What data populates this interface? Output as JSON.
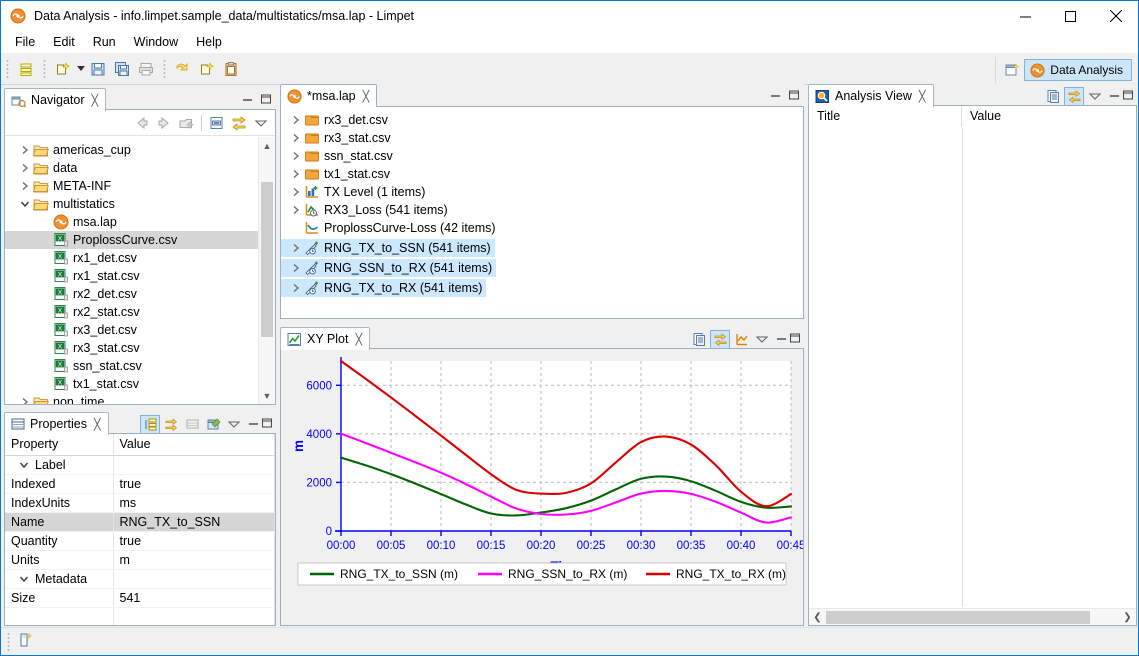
{
  "window": {
    "title": "Data Analysis - info.limpet.sample_data/multistatics/msa.lap - Limpet",
    "app_icon": "limpet-icon",
    "minimize_label": "Minimize",
    "maximize_label": "Maximize",
    "close_label": "Close"
  },
  "menubar": {
    "items": [
      "File",
      "Edit",
      "Run",
      "Window",
      "Help"
    ]
  },
  "toolbar": {
    "buttons": [
      {
        "name": "list-view-icon",
        "title": "Views"
      },
      {
        "name": "new-wizard-icon",
        "title": "New"
      },
      {
        "name": "new-dropdown-arrow",
        "title": "New options"
      },
      {
        "name": "save-icon",
        "title": "Save"
      },
      {
        "name": "save-all-icon",
        "title": "Save All"
      },
      {
        "name": "print-icon",
        "title": "Print"
      },
      {
        "name": "run-icon",
        "title": "Run"
      },
      {
        "name": "new-file-icon",
        "title": "New File"
      },
      {
        "name": "paste-icon",
        "title": "Paste"
      }
    ]
  },
  "perspective": {
    "open_icon": "open-perspective-icon",
    "active": {
      "label": "Data Analysis",
      "icon": "limpet-icon"
    }
  },
  "navigator": {
    "tab": {
      "label": "Navigator",
      "icon": "navigator-icon",
      "close": "╳"
    },
    "tools": [
      {
        "name": "back-icon"
      },
      {
        "name": "forward-icon"
      },
      {
        "name": "up-icon"
      },
      {
        "name": "collapse-all-icon"
      },
      {
        "name": "link-with-editor-icon"
      },
      {
        "name": "view-menu-icon"
      }
    ],
    "view_min": "–",
    "view_max": "❐",
    "items": [
      {
        "label": "americas_cup",
        "icon": "folder-icon",
        "indent": 1,
        "twisty": "collapsed",
        "selected": false
      },
      {
        "label": "data",
        "icon": "folder-icon",
        "indent": 1,
        "twisty": "collapsed",
        "selected": false
      },
      {
        "label": "META-INF",
        "icon": "folder-icon",
        "indent": 1,
        "twisty": "collapsed",
        "selected": false
      },
      {
        "label": "multistatics",
        "icon": "folder-icon",
        "indent": 1,
        "twisty": "expanded",
        "selected": false
      },
      {
        "label": "msa.lap",
        "icon": "limpet-icon",
        "indent": 2,
        "twisty": "none",
        "selected": false
      },
      {
        "label": "ProplossCurve.csv",
        "icon": "csv-icon",
        "indent": 2,
        "twisty": "none",
        "selected": true
      },
      {
        "label": "rx1_det.csv",
        "icon": "csv-icon",
        "indent": 2,
        "twisty": "none",
        "selected": false
      },
      {
        "label": "rx1_stat.csv",
        "icon": "csv-icon",
        "indent": 2,
        "twisty": "none",
        "selected": false
      },
      {
        "label": "rx2_det.csv",
        "icon": "csv-icon",
        "indent": 2,
        "twisty": "none",
        "selected": false
      },
      {
        "label": "rx2_stat.csv",
        "icon": "csv-icon",
        "indent": 2,
        "twisty": "none",
        "selected": false
      },
      {
        "label": "rx3_det.csv",
        "icon": "csv-icon",
        "indent": 2,
        "twisty": "none",
        "selected": false
      },
      {
        "label": "rx3_stat.csv",
        "icon": "csv-icon",
        "indent": 2,
        "twisty": "none",
        "selected": false
      },
      {
        "label": "ssn_stat.csv",
        "icon": "csv-icon",
        "indent": 2,
        "twisty": "none",
        "selected": false
      },
      {
        "label": "tx1_stat.csv",
        "icon": "csv-icon",
        "indent": 2,
        "twisty": "none",
        "selected": false
      },
      {
        "label": "non_time",
        "icon": "folder-icon",
        "indent": 1,
        "twisty": "collapsed",
        "selected": false
      }
    ]
  },
  "properties": {
    "tab": {
      "label": "Properties",
      "icon": "properties-icon",
      "close": "╳"
    },
    "tools": [
      {
        "name": "show-categories-icon",
        "selected": true
      },
      {
        "name": "show-advanced-icon",
        "selected": false
      },
      {
        "name": "restore-default-icon",
        "selected": false
      },
      {
        "name": "pin-properties-icon",
        "selected": false
      },
      {
        "name": "view-menu-icon",
        "selected": false
      }
    ],
    "view_min": "–",
    "view_max": "❐",
    "columns": [
      "Property",
      "Value"
    ],
    "rows": [
      {
        "kind": "group",
        "property": "Label",
        "value": "",
        "selected": false
      },
      {
        "kind": "item",
        "property": "Indexed",
        "value": "true",
        "selected": false
      },
      {
        "kind": "item",
        "property": "IndexUnits",
        "value": "ms",
        "selected": false
      },
      {
        "kind": "item",
        "property": "Name",
        "value": "RNG_TX_to_SSN",
        "selected": true
      },
      {
        "kind": "item",
        "property": "Quantity",
        "value": "true",
        "selected": false
      },
      {
        "kind": "item",
        "property": "Units",
        "value": "m",
        "selected": false
      },
      {
        "kind": "group",
        "property": "Metadata",
        "value": "",
        "selected": false
      },
      {
        "kind": "item",
        "property": "Size",
        "value": "541",
        "selected": false
      }
    ]
  },
  "editor": {
    "tab": {
      "label": "*msa.lap",
      "icon": "limpet-icon",
      "close": "╳"
    },
    "view_min": "–",
    "view_max": "❐",
    "items": [
      {
        "label": "rx3_det.csv",
        "icon": "folder-orange-icon",
        "twisty": "collapsed",
        "selected": false
      },
      {
        "label": "rx3_stat.csv",
        "icon": "folder-orange-icon",
        "twisty": "collapsed",
        "selected": false
      },
      {
        "label": "ssn_stat.csv",
        "icon": "folder-orange-icon",
        "twisty": "collapsed",
        "selected": false
      },
      {
        "label": "tx1_stat.csv",
        "icon": "folder-orange-icon",
        "twisty": "collapsed",
        "selected": false
      },
      {
        "label": "TX Level (1 items)",
        "icon": "series-quantity-icon",
        "twisty": "collapsed",
        "selected": false
      },
      {
        "label": "RX3_Loss (541 items)",
        "icon": "series-temporal-icon",
        "twisty": "collapsed",
        "selected": false
      },
      {
        "label": "ProplossCurve-Loss (42 items)",
        "icon": "series-curve-icon",
        "twisty": "none",
        "selected": false
      },
      {
        "label": "RNG_TX_to_SSN (541 items)",
        "icon": "series-range-icon",
        "twisty": "collapsed",
        "selected": true
      },
      {
        "label": "RNG_SSN_to_RX (541 items)",
        "icon": "series-range-icon",
        "twisty": "collapsed",
        "selected": true
      },
      {
        "label": "RNG_TX_to_RX (541 items)",
        "icon": "series-range-icon",
        "twisty": "collapsed",
        "selected": true
      }
    ]
  },
  "xyplot": {
    "tab": {
      "label": "XY Plot",
      "icon": "chart-icon",
      "close": "╳"
    },
    "tools": [
      {
        "name": "copy-to-clipboard-icon",
        "selected": false
      },
      {
        "name": "link-with-selection-icon",
        "selected": true
      },
      {
        "name": "chart-settings-icon",
        "selected": false
      },
      {
        "name": "view-menu-icon",
        "selected": false
      }
    ],
    "view_min": "–",
    "view_max": "❐"
  },
  "analysis": {
    "tab": {
      "label": "Analysis View",
      "icon": "analysis-icon",
      "close": "╳"
    },
    "tools": [
      {
        "name": "copy-to-clipboard-icon",
        "selected": false
      },
      {
        "name": "link-with-selection-icon",
        "selected": true
      },
      {
        "name": "view-menu-icon",
        "selected": false
      }
    ],
    "view_min": "–",
    "view_max": "❐",
    "columns": [
      "Title",
      "Value"
    ],
    "rows": [],
    "hscroll": {
      "left_arrow": "❮",
      "right_arrow": "❯"
    }
  },
  "statusbar": {
    "icon": "progress-icon"
  },
  "colors": {
    "accent": "#0078d7",
    "tab_selected_bg": "#cde6f7",
    "tab_selected_border": "#7fb5da",
    "tree_selection_blue": "#cce8ff",
    "tree_selection_grey": "#d6d6d6",
    "axis_blue": "#0000ff",
    "series_green": "#006600",
    "series_magenta": "#ff00ff",
    "series_red": "#dd0000",
    "plot_bg": "#ffffff",
    "panel_bg": "#f0f0f0",
    "folder_orange": "#f0a030"
  },
  "chart_data": {
    "type": "line",
    "title": "",
    "xlabel": "Time",
    "ylabel": "m",
    "grid": true,
    "legend_position": "bottom",
    "xlim": [
      0,
      45
    ],
    "ylim": [
      0,
      7000
    ],
    "xticks": [
      "00:00",
      "00:05",
      "00:10",
      "00:15",
      "00:20",
      "00:25",
      "00:30",
      "00:35",
      "00:40",
      "00:45"
    ],
    "xtick_values": [
      0,
      5,
      10,
      15,
      20,
      25,
      30,
      35,
      40,
      45
    ],
    "yticks": [
      0,
      2000,
      4000,
      6000
    ],
    "x": [
      0,
      2.5,
      5,
      7.5,
      10,
      12.5,
      15,
      17.5,
      20,
      22.5,
      25,
      27.5,
      30,
      32.5,
      35,
      37.5,
      40,
      42.5,
      45
    ],
    "series": [
      {
        "name": "RNG_TX_to_SSN (m)",
        "color": "#006600",
        "units": "m",
        "values": [
          3020,
          2700,
          2340,
          1940,
          1520,
          1090,
          720,
          640,
          760,
          940,
          1250,
          1720,
          2150,
          2240,
          2050,
          1650,
          1200,
          960,
          1010
        ]
      },
      {
        "name": "RNG_SSN_to_RX (m)",
        "color": "#ff00ff",
        "units": "m",
        "values": [
          4010,
          3620,
          3220,
          2820,
          2400,
          1930,
          1420,
          930,
          700,
          680,
          830,
          1180,
          1540,
          1650,
          1530,
          1200,
          760,
          350,
          560
        ]
      },
      {
        "name": "RNG_TX_to_RX (m)",
        "color": "#dd0000",
        "units": "m",
        "values": [
          7000,
          6260,
          5500,
          4720,
          3930,
          3130,
          2340,
          1700,
          1540,
          1570,
          1960,
          2830,
          3660,
          3890,
          3560,
          2700,
          1620,
          1020,
          1520
        ]
      }
    ]
  }
}
